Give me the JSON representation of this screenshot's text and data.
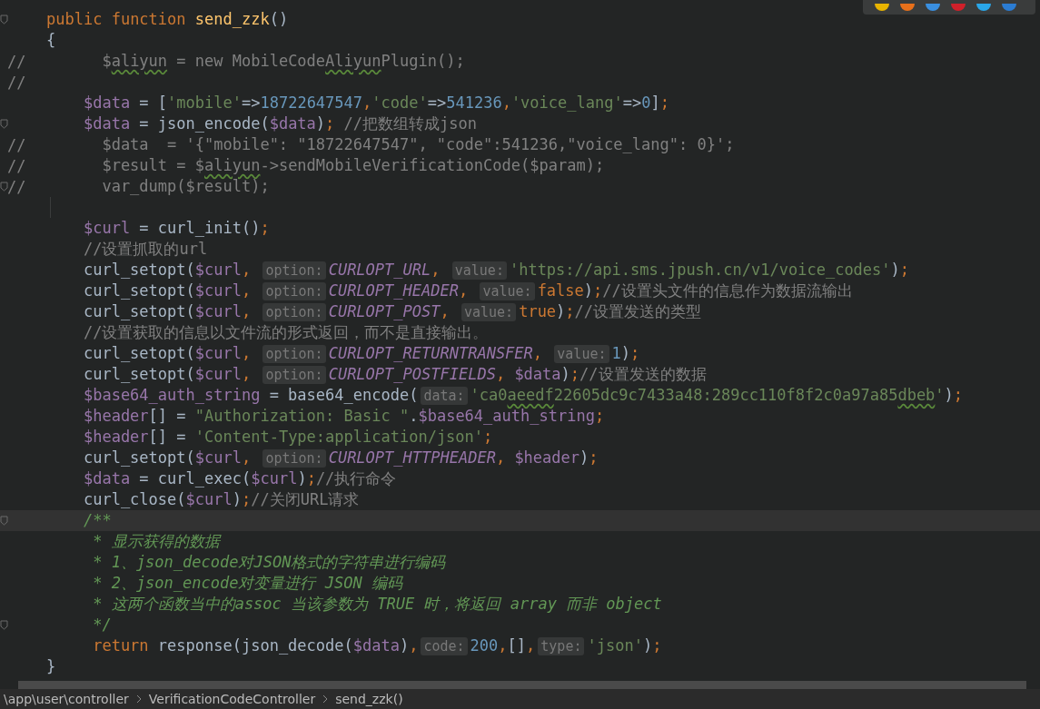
{
  "editor": {
    "lines": [
      {
        "fold": true,
        "tokens": [
          {
            "kind": "kw",
            "text": "public "
          },
          {
            "kind": "kw",
            "text": "function "
          },
          {
            "kind": "fn",
            "text": "send_zzk"
          },
          {
            "kind": "plain",
            "text": "()"
          }
        ]
      },
      {
        "tokens": [
          {
            "kind": "plain",
            "text": "{"
          }
        ]
      },
      {
        "gutter": "//",
        "tokens": [
          {
            "kind": "cmt",
            "text": "      $"
          },
          {
            "kind": "cmt",
            "text": "aliyun",
            "typo": true
          },
          {
            "kind": "cmt",
            "text": " = new MobileCode"
          },
          {
            "kind": "cmt",
            "text": "Aliyun",
            "typo": true
          },
          {
            "kind": "cmt",
            "text": "Plugin();"
          }
        ]
      },
      {
        "gutter": "//"
      },
      {
        "tokens": [
          {
            "kind": "var",
            "text": "    $data"
          },
          {
            "kind": "plain",
            "text": " = ["
          },
          {
            "kind": "str",
            "text": "'mobile'"
          },
          {
            "kind": "plain",
            "text": "=>"
          },
          {
            "kind": "num",
            "text": "18722647547"
          },
          {
            "kind": "punct",
            "text": ","
          },
          {
            "kind": "str",
            "text": "'code'"
          },
          {
            "kind": "plain",
            "text": "=>"
          },
          {
            "kind": "num",
            "text": "541236"
          },
          {
            "kind": "punct",
            "text": ","
          },
          {
            "kind": "str",
            "text": "'voice_lang'"
          },
          {
            "kind": "plain",
            "text": "=>"
          },
          {
            "kind": "num",
            "text": "0"
          },
          {
            "kind": "plain",
            "text": "]"
          },
          {
            "kind": "punct",
            "text": ";"
          }
        ]
      },
      {
        "fold": true,
        "tokens": [
          {
            "kind": "var",
            "text": "    $data"
          },
          {
            "kind": "plain",
            "text": " = json_encode("
          },
          {
            "kind": "var",
            "text": "$data"
          },
          {
            "kind": "plain",
            "text": ")"
          },
          {
            "kind": "punct",
            "text": ";"
          },
          {
            "kind": "cmt",
            "text": " //把数组转成json"
          }
        ]
      },
      {
        "gutter": "//",
        "tokens": [
          {
            "kind": "cmt",
            "text": "      $data  = '{\"mobile\": \"18722647547\", \"code\":541236,\"voice_lang\": 0}';"
          }
        ]
      },
      {
        "gutter": "//",
        "tokens": [
          {
            "kind": "cmt",
            "text": "      $result = $"
          },
          {
            "kind": "cmt",
            "text": "aliyun",
            "typo": true
          },
          {
            "kind": "cmt",
            "text": "->sendMobileVerificationCode($param);"
          }
        ]
      },
      {
        "gutter": "//",
        "fold": true,
        "tokens": [
          {
            "kind": "cmt",
            "text": "      var_dump($result);"
          }
        ]
      },
      {
        "kind": "blank"
      },
      {
        "tokens": [
          {
            "kind": "var",
            "text": "    $curl"
          },
          {
            "kind": "plain",
            "text": " = curl_init()"
          },
          {
            "kind": "punct",
            "text": ";"
          }
        ]
      },
      {
        "tokens": [
          {
            "kind": "cmt",
            "text": "    //设置抓取的url"
          }
        ]
      },
      {
        "tokens": [
          {
            "kind": "plain",
            "text": "    curl_setopt("
          },
          {
            "kind": "var",
            "text": "$curl"
          },
          {
            "kind": "punct",
            "text": ", "
          },
          {
            "kind": "hint",
            "text": "option:"
          },
          {
            "kind": "const",
            "text": "CURLOPT_URL"
          },
          {
            "kind": "punct",
            "text": ", "
          },
          {
            "kind": "hint",
            "text": "value:"
          },
          {
            "kind": "str",
            "text": "'https://api.sms.jpush.cn/v1/voice_codes'"
          },
          {
            "kind": "plain",
            "text": ")"
          },
          {
            "kind": "punct",
            "text": ";"
          }
        ]
      },
      {
        "tokens": [
          {
            "kind": "plain",
            "text": "    curl_setopt("
          },
          {
            "kind": "var",
            "text": "$curl"
          },
          {
            "kind": "punct",
            "text": ", "
          },
          {
            "kind": "hint",
            "text": "option:"
          },
          {
            "kind": "const",
            "text": "CURLOPT_HEADER"
          },
          {
            "kind": "punct",
            "text": ", "
          },
          {
            "kind": "hint",
            "text": "value:"
          },
          {
            "kind": "kw",
            "text": "false"
          },
          {
            "kind": "plain",
            "text": ")"
          },
          {
            "kind": "punct",
            "text": ";"
          },
          {
            "kind": "cmt",
            "text": "//设置头文件的信息作为数据流输出"
          }
        ]
      },
      {
        "tokens": [
          {
            "kind": "plain",
            "text": "    curl_setopt("
          },
          {
            "kind": "var",
            "text": "$curl"
          },
          {
            "kind": "punct",
            "text": ", "
          },
          {
            "kind": "hint",
            "text": "option:"
          },
          {
            "kind": "const",
            "text": "CURLOPT_POST"
          },
          {
            "kind": "punct",
            "text": ", "
          },
          {
            "kind": "hint",
            "text": "value:"
          },
          {
            "kind": "kw",
            "text": "true"
          },
          {
            "kind": "plain",
            "text": ")"
          },
          {
            "kind": "punct",
            "text": ";"
          },
          {
            "kind": "cmt",
            "text": "//设置发送的类型"
          }
        ]
      },
      {
        "tokens": [
          {
            "kind": "cmt",
            "text": "    //设置获取的信息以文件流的形式返回，而不是直接输出。"
          }
        ]
      },
      {
        "tokens": [
          {
            "kind": "plain",
            "text": "    curl_setopt("
          },
          {
            "kind": "var",
            "text": "$curl"
          },
          {
            "kind": "punct",
            "text": ", "
          },
          {
            "kind": "hint",
            "text": "option:"
          },
          {
            "kind": "const",
            "text": "CURLOPT_RETURNTRANSFER"
          },
          {
            "kind": "punct",
            "text": ", "
          },
          {
            "kind": "hint",
            "text": "value:"
          },
          {
            "kind": "num",
            "text": "1"
          },
          {
            "kind": "plain",
            "text": ")"
          },
          {
            "kind": "punct",
            "text": ";"
          }
        ]
      },
      {
        "tokens": [
          {
            "kind": "plain",
            "text": "    curl_setopt("
          },
          {
            "kind": "var",
            "text": "$curl"
          },
          {
            "kind": "punct",
            "text": ", "
          },
          {
            "kind": "hint",
            "text": "option:"
          },
          {
            "kind": "const",
            "text": "CURLOPT_POSTFIELDS"
          },
          {
            "kind": "punct",
            "text": ", "
          },
          {
            "kind": "var",
            "text": "$data"
          },
          {
            "kind": "plain",
            "text": ")"
          },
          {
            "kind": "punct",
            "text": ";"
          },
          {
            "kind": "cmt",
            "text": "//设置发送的数据"
          }
        ]
      },
      {
        "tokens": [
          {
            "kind": "var",
            "text": "    $base64_auth_string"
          },
          {
            "kind": "plain",
            "text": " = base64_encode("
          },
          {
            "kind": "hint",
            "text": "data:"
          },
          {
            "kind": "str",
            "text": "'ca0"
          },
          {
            "kind": "str",
            "text": "aeedf",
            "typo": true
          },
          {
            "kind": "str",
            "text": "22605dc9c7433a48:289cc110f8f2c0a97a85"
          },
          {
            "kind": "str",
            "text": "dbeb",
            "typo": true
          },
          {
            "kind": "str",
            "text": "'"
          },
          {
            "kind": "plain",
            "text": ")"
          },
          {
            "kind": "punct",
            "text": ";"
          }
        ]
      },
      {
        "tokens": [
          {
            "kind": "var",
            "text": "    $header"
          },
          {
            "kind": "plain",
            "text": "[] = "
          },
          {
            "kind": "str",
            "text": "\"Authorization: Basic \""
          },
          {
            "kind": "plain",
            "text": "."
          },
          {
            "kind": "var",
            "text": "$base64_auth_string"
          },
          {
            "kind": "punct",
            "text": ";"
          }
        ]
      },
      {
        "tokens": [
          {
            "kind": "var",
            "text": "    $header"
          },
          {
            "kind": "plain",
            "text": "[] = "
          },
          {
            "kind": "str",
            "text": "'Content-Type:application/json'"
          },
          {
            "kind": "punct",
            "text": ";"
          }
        ]
      },
      {
        "tokens": [
          {
            "kind": "plain",
            "text": "    curl_setopt("
          },
          {
            "kind": "var",
            "text": "$curl"
          },
          {
            "kind": "punct",
            "text": ", "
          },
          {
            "kind": "hint",
            "text": "option:"
          },
          {
            "kind": "const",
            "text": "CURLOPT_HTTPHEADER"
          },
          {
            "kind": "punct",
            "text": ", "
          },
          {
            "kind": "var",
            "text": "$header"
          },
          {
            "kind": "plain",
            "text": ")"
          },
          {
            "kind": "punct",
            "text": ";"
          }
        ]
      },
      {
        "tokens": [
          {
            "kind": "var",
            "text": "    $data"
          },
          {
            "kind": "plain",
            "text": " = curl_exec("
          },
          {
            "kind": "var",
            "text": "$curl"
          },
          {
            "kind": "plain",
            "text": ")"
          },
          {
            "kind": "punct",
            "text": ";"
          },
          {
            "kind": "cmt",
            "text": "//执行命令"
          }
        ]
      },
      {
        "tokens": [
          {
            "kind": "plain",
            "text": "    curl_close("
          },
          {
            "kind": "var",
            "text": "$curl"
          },
          {
            "kind": "plain",
            "text": ")"
          },
          {
            "kind": "punct",
            "text": ";"
          },
          {
            "kind": "cmt",
            "text": "//关闭URL请求"
          }
        ]
      },
      {
        "current": true,
        "fold": true,
        "tokens": [
          {
            "kind": "doc",
            "text": "    /**"
          }
        ]
      },
      {
        "tokens": [
          {
            "kind": "doc",
            "text": "     * 显示获得的数据"
          }
        ]
      },
      {
        "tokens": [
          {
            "kind": "doc",
            "text": "     * 1、json_decode对JSON格式的字符串进行编码"
          }
        ]
      },
      {
        "tokens": [
          {
            "kind": "doc",
            "text": "     * 2、json_encode对变量进行 JSON 编码"
          }
        ]
      },
      {
        "tokens": [
          {
            "kind": "doc",
            "text": "     * 这两个函数当中的assoc 当该参数为 TRUE 时，将返回 array 而非 object"
          }
        ]
      },
      {
        "fold": true,
        "tokens": [
          {
            "kind": "doc",
            "text": "     */"
          }
        ]
      },
      {
        "tokens": [
          {
            "kind": "kw",
            "text": "     return"
          },
          {
            "kind": "plain",
            "text": " response(json_decode("
          },
          {
            "kind": "var",
            "text": "$data"
          },
          {
            "kind": "plain",
            "text": ")"
          },
          {
            "kind": "punct",
            "text": ","
          },
          {
            "kind": "hint",
            "text": "code:"
          },
          {
            "kind": "num",
            "text": "200"
          },
          {
            "kind": "punct",
            "text": ","
          },
          {
            "kind": "plain",
            "text": "[]"
          },
          {
            "kind": "punct",
            "text": ","
          },
          {
            "kind": "hint",
            "text": "type:"
          },
          {
            "kind": "str",
            "text": "'json'"
          },
          {
            "kind": "plain",
            "text": ")"
          },
          {
            "kind": "punct",
            "text": ";"
          }
        ]
      },
      {
        "tokens": [
          {
            "kind": "plain",
            "text": "}"
          }
        ]
      }
    ]
  },
  "browser_icons": [
    {
      "color": "#e8b400"
    },
    {
      "color": "#e8701a"
    },
    {
      "color": "#3a8fe0"
    },
    {
      "color": "#d0202a"
    },
    {
      "color": "#2aa6e8"
    },
    {
      "color": "#2b7cd3"
    }
  ],
  "breadcrumb": [
    "\\app\\user\\controller",
    "VerificationCodeController",
    "send_zzk()"
  ]
}
